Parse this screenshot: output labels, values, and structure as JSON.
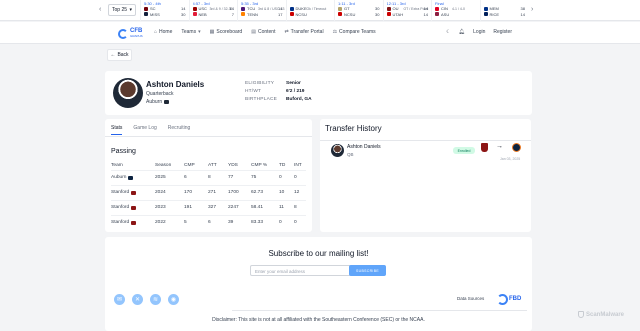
{
  "ticker": {
    "filter_label": "Top 25",
    "games": [
      {
        "status": "5:30 - 4th",
        "away": "SC",
        "away_score": "14",
        "home": "MISS",
        "home_score": "30",
        "mid": "",
        "away_color": "#73000a",
        "home_color": "#14213d"
      },
      {
        "status": "4:57 - 3rd",
        "away": "USC",
        "away_score": "14",
        "home": "NEB",
        "home_score": "7",
        "mid": "3rd & 9 / 32-35",
        "away_color": "#990000",
        "home_color": "#e41c38"
      },
      {
        "status": "5:35 - 3rd",
        "away": "TCU",
        "away_score": "14",
        "home": "TENN",
        "home_score": "17",
        "mid": "3rd & 8 / USC 33",
        "away_color": "#4d1979",
        "home_color": "#ff8200"
      },
      {
        "status": "",
        "away": "DUKE",
        "away_score": "",
        "home": "NCSU",
        "home_score": "",
        "mid": "Ok / Timeout",
        "away_color": "#003087",
        "home_color": "#cc0000"
      },
      {
        "status": "1:11 - 3rd",
        "away": "GT",
        "away_score": "30",
        "home": "NCSU",
        "home_score": "30",
        "mid": "",
        "away_color": "#b3a369",
        "home_color": "#cc0000"
      },
      {
        "status": "12:11 - 3rd",
        "away": "OU",
        "away_score": "14",
        "home": "UTAH",
        "home_score": "14",
        "mid": "OT / Extra Point",
        "away_color": "#841617",
        "home_color": "#cc0000"
      },
      {
        "status": "Final",
        "away": "CIN",
        "away_score": "",
        "home": "ASU",
        "home_score": "",
        "mid": "4-1 / 4-0",
        "away_color": "#e00122",
        "home_color": "#8c1d40"
      },
      {
        "status": "",
        "away": "MEM",
        "away_score": "38",
        "home": "RICE",
        "home_score": "14",
        "mid": "",
        "away_color": "#003087",
        "home_color": "#00205b"
      }
    ]
  },
  "nav": {
    "brand_top": "CFB",
    "brand_bottom": "GRAPHS",
    "links": [
      "Home",
      "Teams",
      "Scoreboard",
      "Content",
      "Transfer Portal",
      "Compare Teams"
    ],
    "login": "Login",
    "register": "Register"
  },
  "back_label": "Back",
  "player": {
    "name": "Ashton Daniels",
    "position": "Quarterback",
    "team": "Auburn",
    "attributes": [
      {
        "key": "ELIGIBILITY",
        "value": "Senior"
      },
      {
        "key": "HT/WT",
        "value": "6'2 / 219"
      },
      {
        "key": "BIRTHPLACE",
        "value": "Buford, GA"
      }
    ]
  },
  "stats": {
    "tabs": [
      "Stats",
      "Game Log",
      "Recruiting"
    ],
    "section": "Passing",
    "headers": [
      "Team",
      "Season",
      "CMP",
      "ATT",
      "YDS",
      "CMP %",
      "TD",
      "INT"
    ],
    "rows": [
      {
        "team": "Auburn",
        "season": "2025",
        "cmp": "6",
        "att": "8",
        "yds": "77",
        "pct": "75",
        "td": "0",
        "int": "0",
        "color": "#0c2340"
      },
      {
        "team": "Stanford",
        "season": "2024",
        "cmp": "170",
        "att": "271",
        "yds": "1700",
        "pct": "62.73",
        "td": "10",
        "int": "12",
        "color": "#8c1515"
      },
      {
        "team": "Stanford",
        "season": "2023",
        "cmp": "191",
        "att": "327",
        "yds": "2247",
        "pct": "58.41",
        "td": "11",
        "int": "8",
        "color": "#8c1515"
      },
      {
        "team": "Stanford",
        "season": "2022",
        "cmp": "5",
        "att": "6",
        "yds": "39",
        "pct": "83.33",
        "td": "0",
        "int": "0",
        "color": "#8c1515"
      }
    ]
  },
  "transfer": {
    "title": "Transfer History",
    "name": "Ashton Daniels",
    "position": "QB",
    "status": "Enrolled",
    "arrow": "→",
    "date": "Jan 03, 2025"
  },
  "footer": {
    "subscribe_title": "Subscribe to our mailing list!",
    "email_placeholder": "Enter your email address",
    "subscribe_label": "SUBSCRIBE",
    "data_sources": "Data Sources",
    "fbd": "FBD",
    "disclaimer": "Disclaimer: This site is not at all affiliated with the Southeastern Conference (SEC) or the NCAA.",
    "socials": [
      "email-icon",
      "x-icon",
      "spotify-icon",
      "podcast-icon"
    ]
  },
  "watermark": "ScanMalware"
}
